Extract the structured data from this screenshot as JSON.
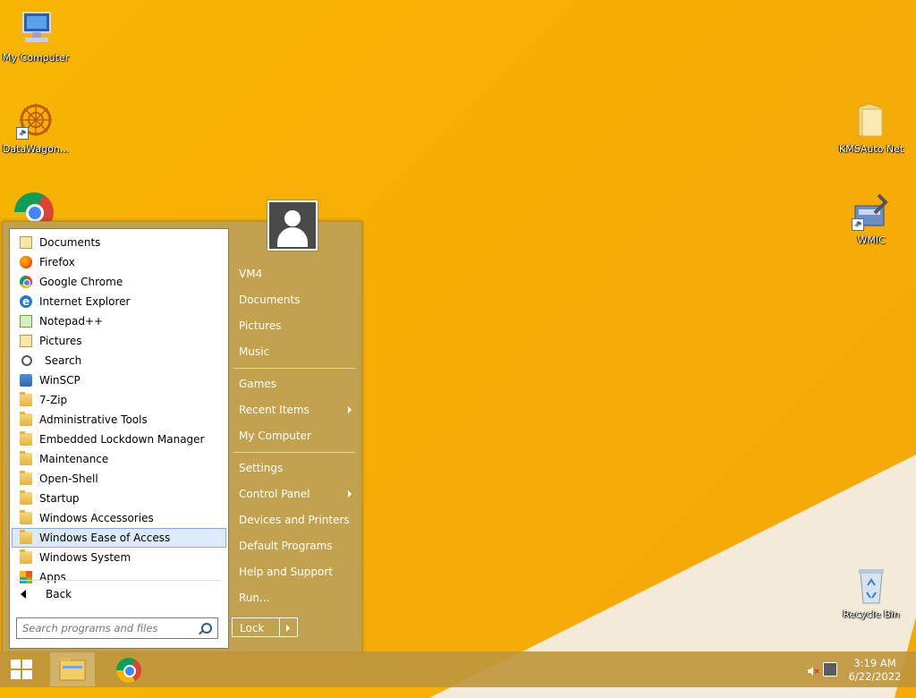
{
  "desktop": {
    "icons": [
      {
        "label": "My Computer",
        "icon": "computer-icon"
      },
      {
        "label": "DataWagon...",
        "icon": "datawagon-icon"
      },
      {
        "label": "KMSAuto Net",
        "icon": "folder-icon"
      },
      {
        "label": "WMIC",
        "icon": "wmic-icon"
      },
      {
        "label": "Recycle Bin",
        "icon": "recycle-bin-icon"
      }
    ]
  },
  "start_menu": {
    "programs": [
      {
        "label": "Documents",
        "icon": "documents-icon"
      },
      {
        "label": "Firefox",
        "icon": "firefox-icon"
      },
      {
        "label": "Google Chrome",
        "icon": "chrome-icon"
      },
      {
        "label": "Internet Explorer",
        "icon": "ie-icon"
      },
      {
        "label": "Notepad++",
        "icon": "notepadpp-icon"
      },
      {
        "label": "Pictures",
        "icon": "pictures-icon"
      },
      {
        "label": "Search",
        "icon": "search-icon"
      },
      {
        "label": "WinSCP",
        "icon": "winscp-icon"
      },
      {
        "label": "7-Zip",
        "icon": "folder-icon"
      },
      {
        "label": "Administrative Tools",
        "icon": "folder-icon"
      },
      {
        "label": "Embedded Lockdown Manager",
        "icon": "folder-icon"
      },
      {
        "label": "Maintenance",
        "icon": "folder-icon"
      },
      {
        "label": "Open-Shell",
        "icon": "folder-icon"
      },
      {
        "label": "Startup",
        "icon": "folder-icon"
      },
      {
        "label": "Windows Accessories",
        "icon": "folder-icon"
      },
      {
        "label": "Windows Ease of Access",
        "icon": "folder-icon",
        "selected": true
      },
      {
        "label": "Windows System",
        "icon": "folder-icon"
      },
      {
        "label": "Apps",
        "icon": "apps-icon"
      }
    ],
    "back_label": "Back",
    "search_placeholder": "Search programs and files",
    "right_items": [
      {
        "label": "VM4"
      },
      {
        "label": "Documents"
      },
      {
        "label": "Pictures"
      },
      {
        "label": "Music"
      },
      {
        "label": "Games"
      },
      {
        "label": "Recent Items",
        "submenu": true
      },
      {
        "label": "My Computer"
      },
      {
        "label": "Settings"
      },
      {
        "label": "Control Panel",
        "submenu": true
      },
      {
        "label": "Devices and Printers"
      },
      {
        "label": "Default Programs"
      },
      {
        "label": "Help and Support"
      },
      {
        "label": "Run..."
      }
    ],
    "lock_label": "Lock"
  },
  "taskbar": {
    "time": "3:19 AM",
    "date": "6/22/2022"
  }
}
